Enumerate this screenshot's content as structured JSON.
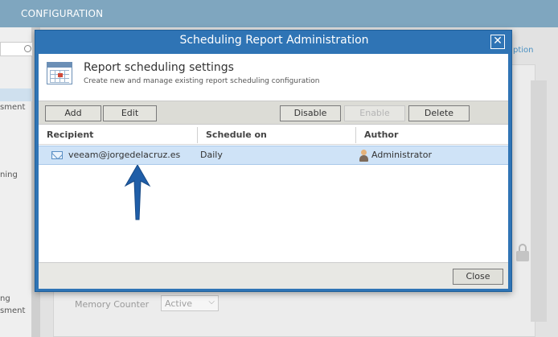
{
  "app": {
    "header_title": "CONFIGURATION",
    "left_items": [
      "sment",
      "ning",
      "ng",
      "sment"
    ],
    "option_link": "ption",
    "memory_counter_label": "Memory Counter",
    "memory_counter_value": "Active"
  },
  "dialog": {
    "title": "Scheduling Report Administration",
    "close_symbol": "✕",
    "header": {
      "title": "Report scheduling settings",
      "subtitle": "Create new and manage existing report scheduling configuration"
    },
    "toolbar": {
      "add": "Add",
      "edit": "Edit",
      "disable": "Disable",
      "enable": "Enable",
      "delete": "Delete"
    },
    "columns": [
      "Recipient",
      "Schedule on",
      "Author"
    ],
    "rows": [
      {
        "recipient": "veeam@jorgedelacruz.es",
        "schedule": "Daily",
        "author": "Administrator"
      }
    ],
    "close_label": "Close"
  },
  "colors": {
    "dialog_blue": "#2f74b5",
    "header_blue": "#7fa6bf",
    "selected_row": "#cfe3f7",
    "arrow": "#1f5ea8"
  },
  "icons": [
    "close-icon",
    "calendar-icon",
    "mail-icon",
    "user-icon",
    "lock-icon",
    "search-icon",
    "arrow-up-annotation"
  ]
}
